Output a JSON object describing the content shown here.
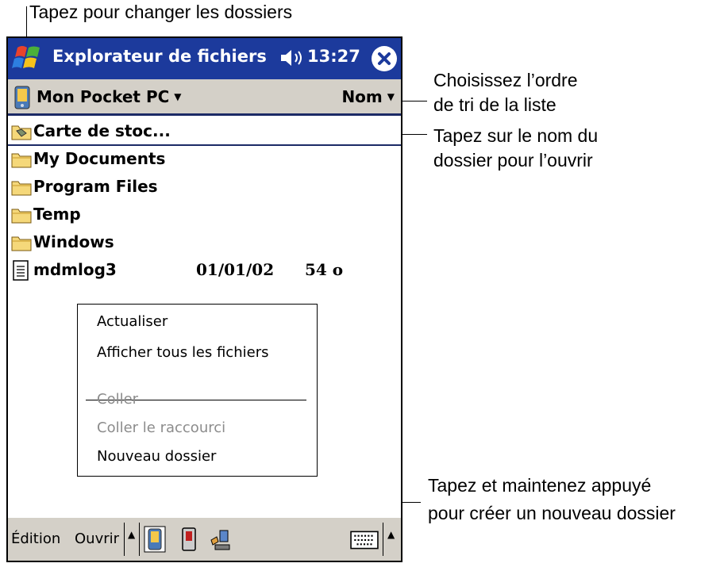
{
  "callouts": {
    "change_folders": "Tapez pour changer les dossiers",
    "sort_order_line1": "Choisissez l’ordre",
    "sort_order_line2": "de tri de la liste",
    "open_folder_line1": "Tapez sur le nom du",
    "open_folder_line2": "dossier pour l’ouvrir",
    "new_folder_line1": "Tapez et maintenez appuyé",
    "new_folder_line2": "pour créer un nouveau dossier"
  },
  "titlebar": {
    "title": "Explorateur de fichiers",
    "time": "13:27",
    "accent_color": "#1c3a9c"
  },
  "pathbar": {
    "current_folder": "Mon Pocket PC",
    "sort_by": "Nom"
  },
  "files": [
    {
      "name": "Carte de stoc...",
      "icon": "storage-card-icon",
      "date": "",
      "size": ""
    },
    {
      "name": "My Documents",
      "icon": "folder-icon",
      "date": "",
      "size": ""
    },
    {
      "name": "Program Files",
      "icon": "folder-icon",
      "date": "",
      "size": ""
    },
    {
      "name": "Temp",
      "icon": "folder-icon",
      "date": "",
      "size": ""
    },
    {
      "name": "Windows",
      "icon": "folder-icon",
      "date": "",
      "size": ""
    },
    {
      "name": "mdmlog3",
      "icon": "document-icon",
      "date": "01/01/02",
      "size": "54 o"
    }
  ],
  "context_menu": {
    "refresh": "Actualiser",
    "show_all": "Afficher tous les fichiers",
    "paste": "Coller",
    "paste_shortcut": "Coller le raccourci",
    "new_folder": "Nouveau dossier"
  },
  "menubar": {
    "edit": "Édition",
    "open": "Ouvrir"
  }
}
